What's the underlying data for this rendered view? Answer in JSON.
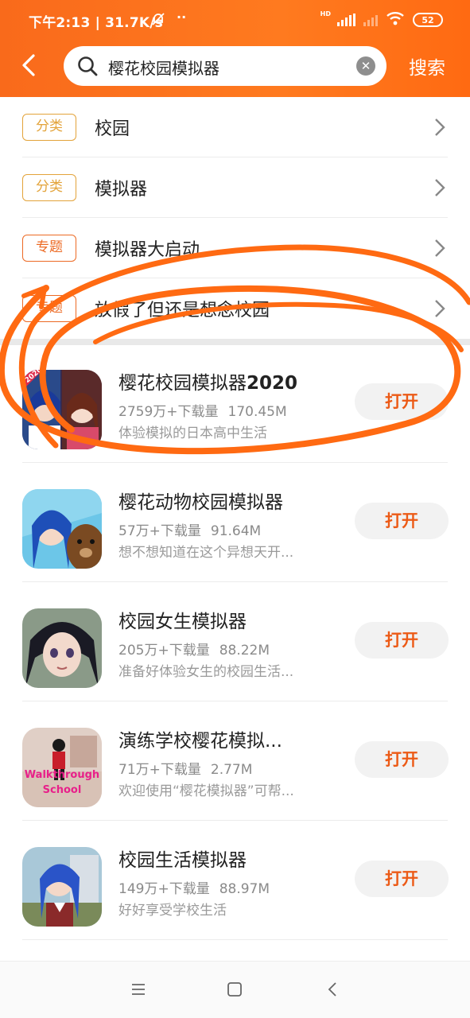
{
  "status_bar": {
    "time_speed": "下午2:13 | 31.7K/s",
    "dots": "··",
    "battery": "52"
  },
  "header": {
    "search_value": "樱花校园模拟器",
    "search_button": "搜索"
  },
  "suggestions": [
    {
      "tag": "分类",
      "label": "校园"
    },
    {
      "tag": "分类",
      "label": "模拟器"
    },
    {
      "tag": "专题",
      "label": "模拟器大启动"
    },
    {
      "tag": "专题",
      "label": "放假了但还是想念校园"
    }
  ],
  "apps": [
    {
      "name_main": "樱花校园模拟器",
      "name_suffix": "2020",
      "downloads": "2759万+下载量",
      "size": "170.45M",
      "desc": "体验模拟的日本高中生活",
      "button": "打开"
    },
    {
      "name_main": "樱花动物校园模拟器",
      "name_suffix": "",
      "downloads": "57万+下载量",
      "size": "91.64M",
      "desc": "想不想知道在这个异想天开...",
      "button": "打开"
    },
    {
      "name_main": "校园女生模拟器",
      "name_suffix": "",
      "downloads": "205万+下载量",
      "size": "88.22M",
      "desc": "准备好体验女生的校园生活...",
      "button": "打开"
    },
    {
      "name_main": "演练学校樱花模拟...",
      "name_suffix": "",
      "downloads": "71万+下载量",
      "size": "2.77M",
      "desc": "欢迎使用“樱花模拟器”可帮...",
      "button": "打开"
    },
    {
      "name_main": "校园生活模拟器",
      "name_suffix": "",
      "downloads": "149万+下载量",
      "size": "88.97M",
      "desc": "好好享受学校生活",
      "button": "打开"
    }
  ],
  "icon_text": {
    "app0_badge": "2020",
    "app3_line1": "Walkthrough",
    "app3_line2": "School"
  },
  "colors": {
    "brand_orange": "#ff7a1f",
    "open_text": "#ec5a16",
    "category_tag": "#e3a33a",
    "topic_tag": "#ec6a24"
  }
}
